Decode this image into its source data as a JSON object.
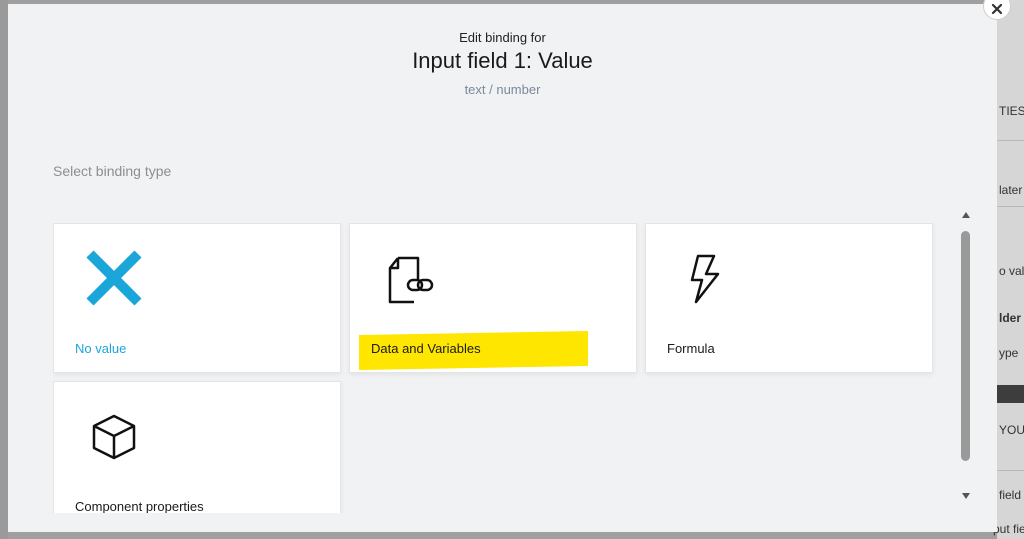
{
  "modal": {
    "edit_for": "Edit binding for",
    "title": "Input field 1: Value",
    "subtitle": "text / number",
    "section_label": "Select binding type"
  },
  "cards": [
    {
      "label": "No value",
      "icon": "x-icon"
    },
    {
      "label": "Data and Variables",
      "icon": "linked-document-icon"
    },
    {
      "label": "Formula",
      "icon": "lightning-bolt-icon"
    },
    {
      "label": "Component properties",
      "icon": "cube-icon"
    }
  ],
  "background_fragments": {
    "r1": "TIES",
    "r2": "later",
    "r3": "o val",
    "r4": "lder",
    "r5": "ype",
    "r6": "YOU",
    "r7": "field",
    "r8": "put field"
  },
  "colors": {
    "accent": "#1ba6d9",
    "highlight": "#ffe600",
    "modal_bg": "#f1f2f3"
  }
}
